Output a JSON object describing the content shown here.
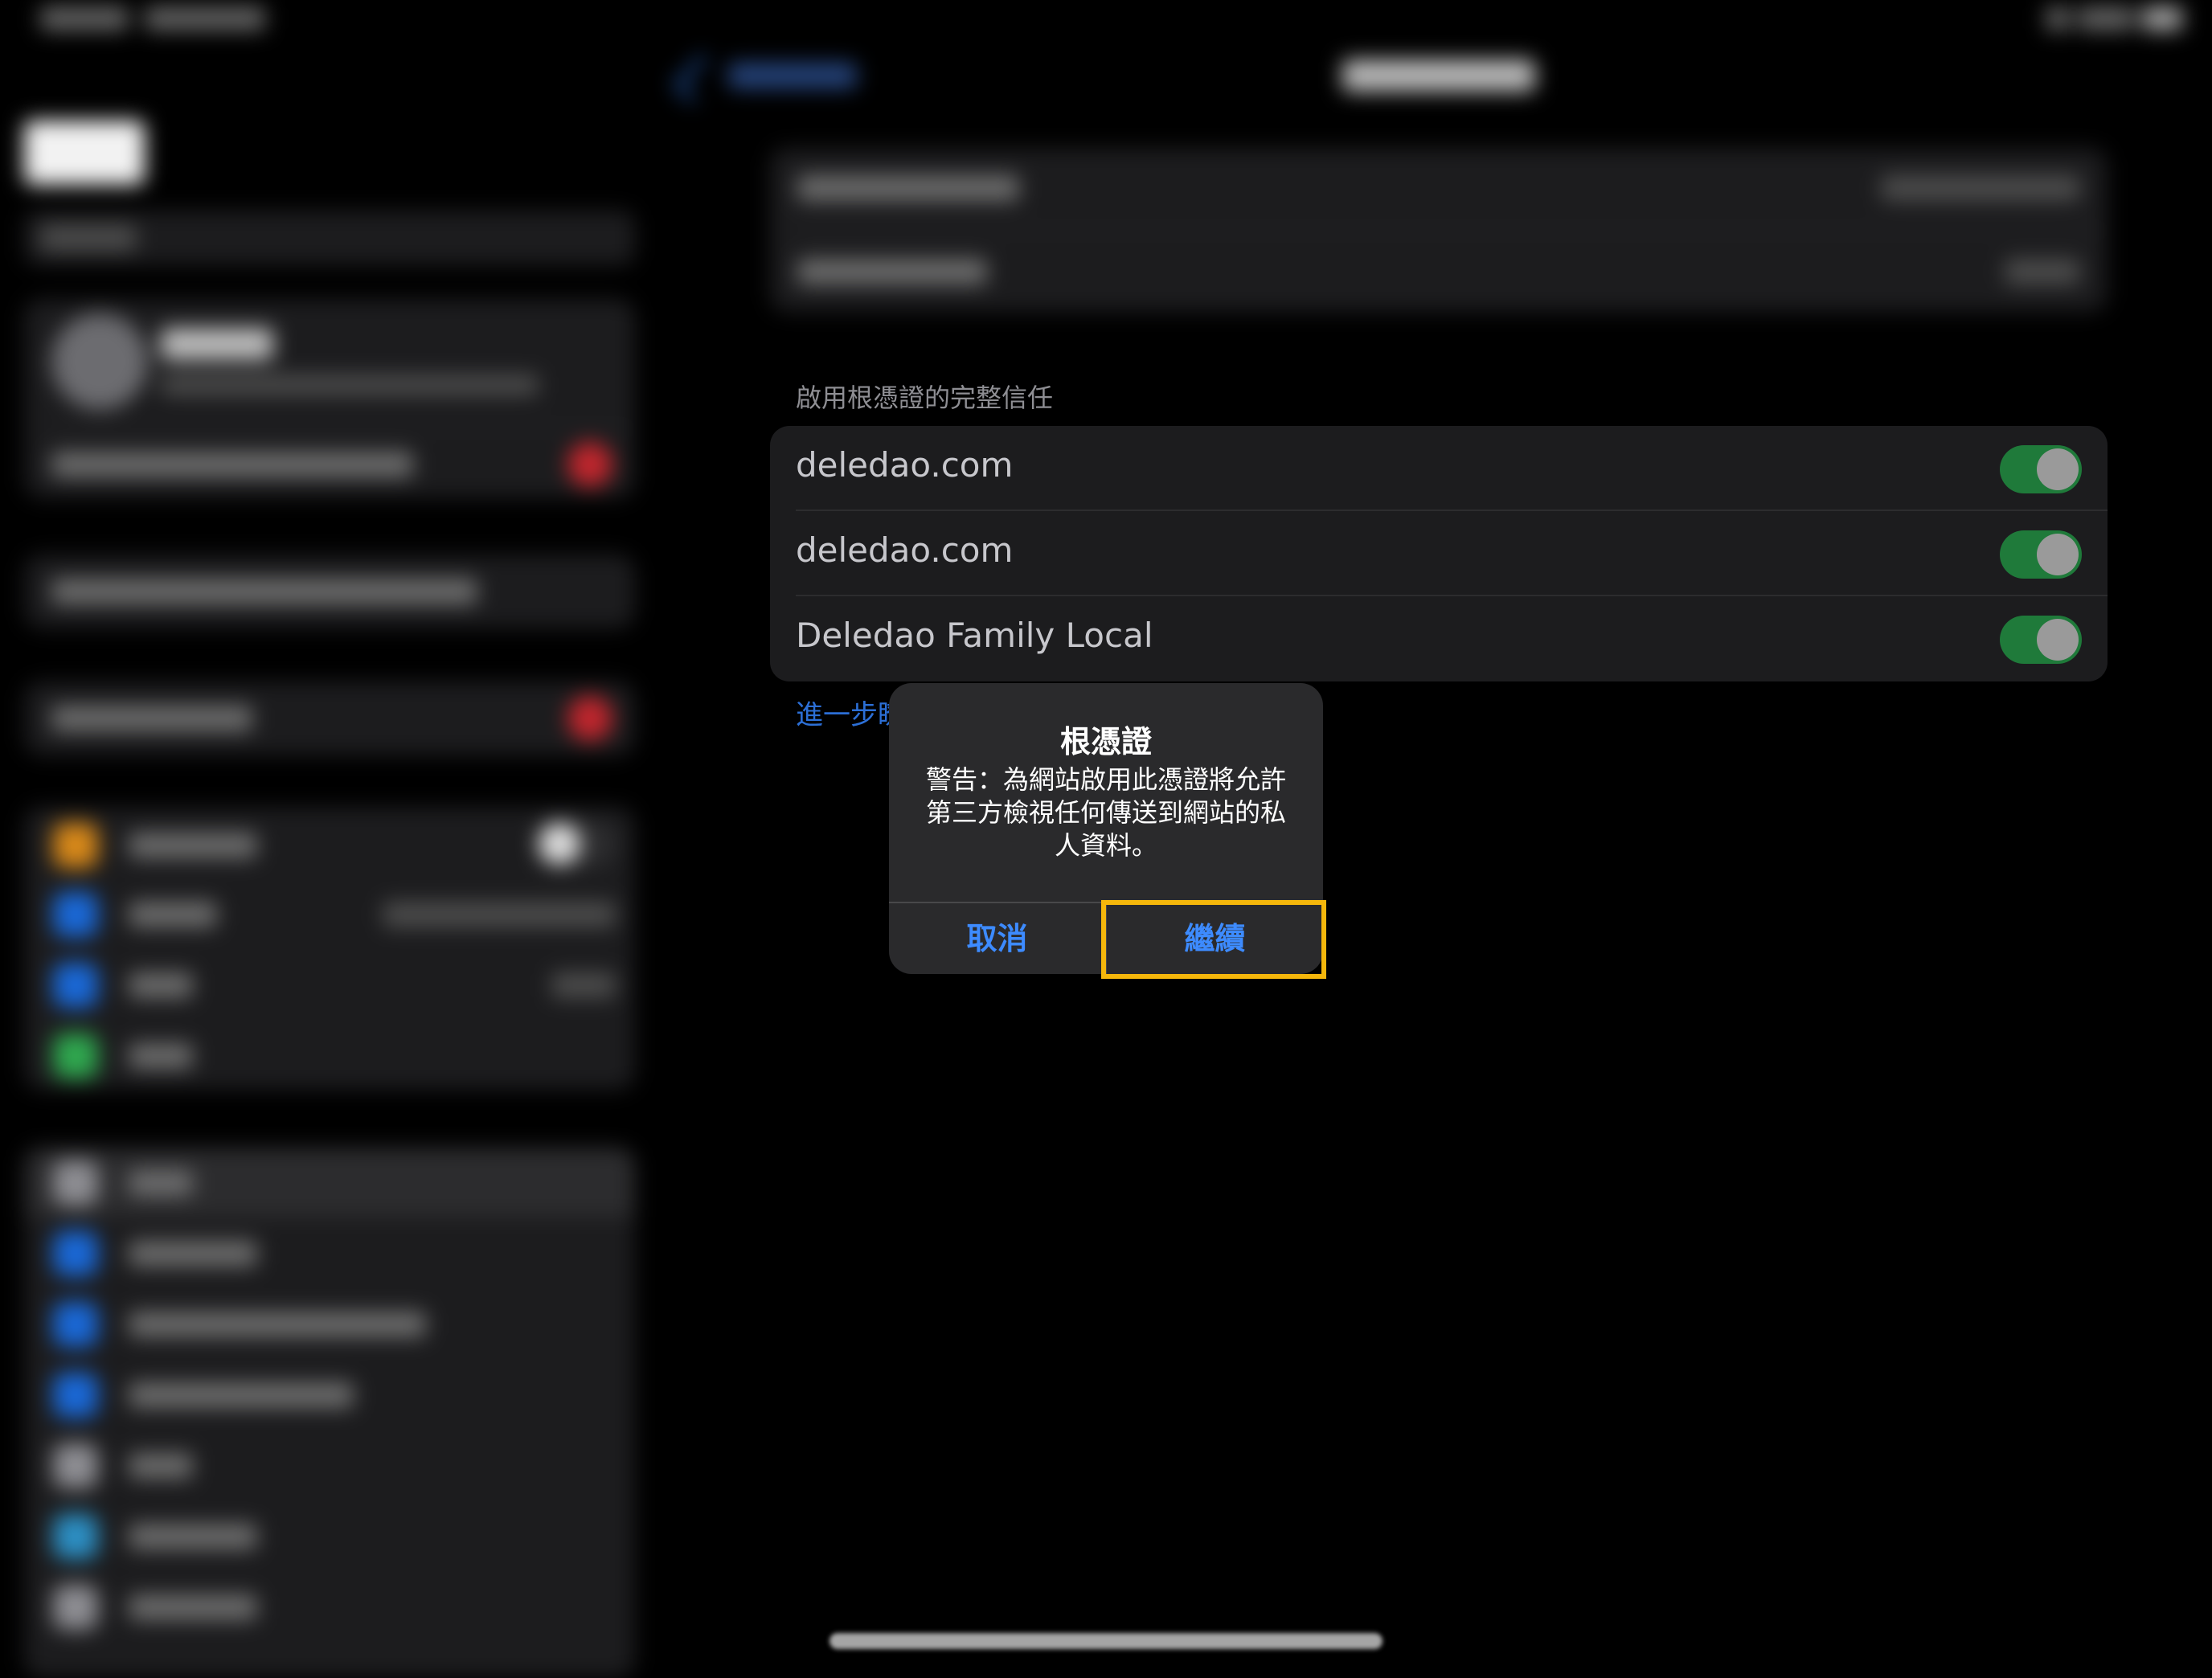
{
  "colors": {
    "background": "#000000",
    "card": "#1c1c1e",
    "toggle_on": "#1f7a3a",
    "link_blue": "#3d8bff",
    "highlight": "#f5b70b"
  },
  "trust_settings": {
    "section_header": "啟用根憑證的完整信任",
    "rows": [
      {
        "label": "deledao.com",
        "enabled": true
      },
      {
        "label": "deledao.com",
        "enabled": true
      },
      {
        "label": "Deledao Family Local",
        "enabled": true
      }
    ],
    "learn_more_partial": "進一步瞭"
  },
  "alert": {
    "title": "根憑證",
    "message": "警告：為網站啟用此憑證將允許第三方檢視任何傳送到網站的私人資料。",
    "cancel_label": "取消",
    "continue_label": "繼續"
  }
}
